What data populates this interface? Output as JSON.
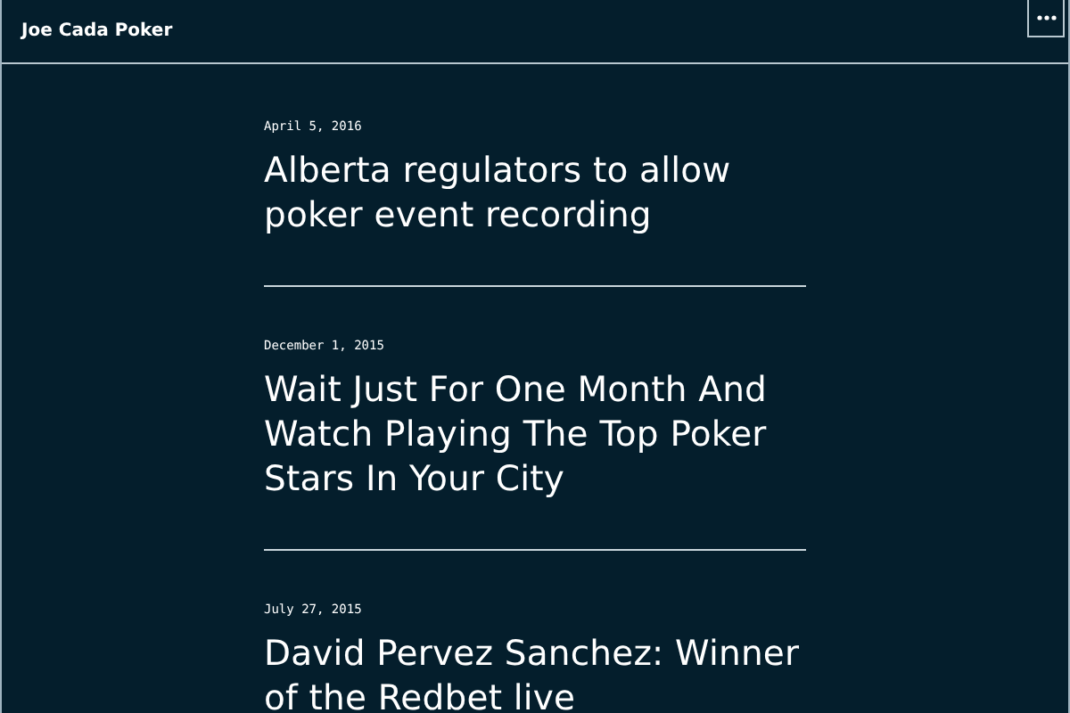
{
  "site_title": "Joe Cada Poker",
  "posts": [
    {
      "date": "April 5, 2016",
      "title": "Alberta regulators to allow poker event recording"
    },
    {
      "date": "December 1, 2015",
      "title": "Wait Just For One Month And Watch Playing The Top Poker Stars In Your City"
    },
    {
      "date": "July 27, 2015",
      "title": "David Pervez Sanchez: Winner of the Redbet live"
    }
  ]
}
